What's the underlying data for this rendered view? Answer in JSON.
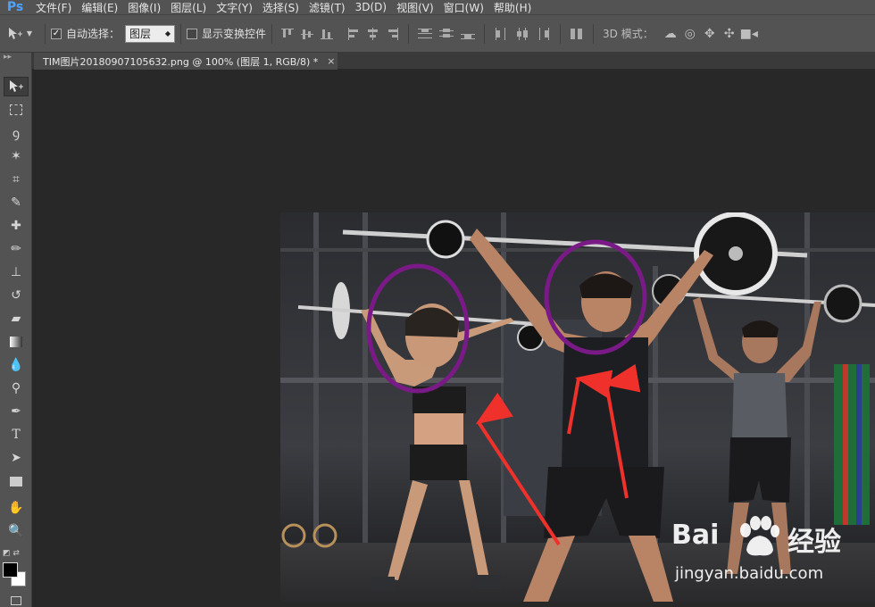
{
  "app": {
    "logo": "Ps",
    "menu": [
      "文件(F)",
      "编辑(E)",
      "图像(I)",
      "图层(L)",
      "文字(Y)",
      "选择(S)",
      "滤镜(T)",
      "3D(D)",
      "视图(V)",
      "窗口(W)",
      "帮助(H)"
    ]
  },
  "options": {
    "auto_select_label": "自动选择：",
    "auto_select_checked": true,
    "layer_select_value": "图层",
    "show_transform_label": "显示变换控件",
    "mode3d_label": "3D 模式："
  },
  "document": {
    "tab_title": "TIM图片20180907105632.png @ 100% (图层 1, RGB/8) *",
    "tab_close": "×"
  },
  "toolbar": {
    "tools": [
      "move",
      "marquee",
      "lasso",
      "magic-wand",
      "crop",
      "eyedropper",
      "healing",
      "brush",
      "clone-stamp",
      "history-brush",
      "eraser",
      "gradient",
      "blur",
      "dodge",
      "pen",
      "type",
      "path-select",
      "rectangle",
      "hand",
      "zoom"
    ],
    "foreground_color": "#000000",
    "background_color": "#ffffff"
  },
  "watermark": {
    "brand": "Bai",
    "brand_cn": "经验",
    "site": "jingyan.baidu.com"
  },
  "annotations": {
    "circle_color": "#7a1a86",
    "arrow_color": "#f0302a"
  }
}
